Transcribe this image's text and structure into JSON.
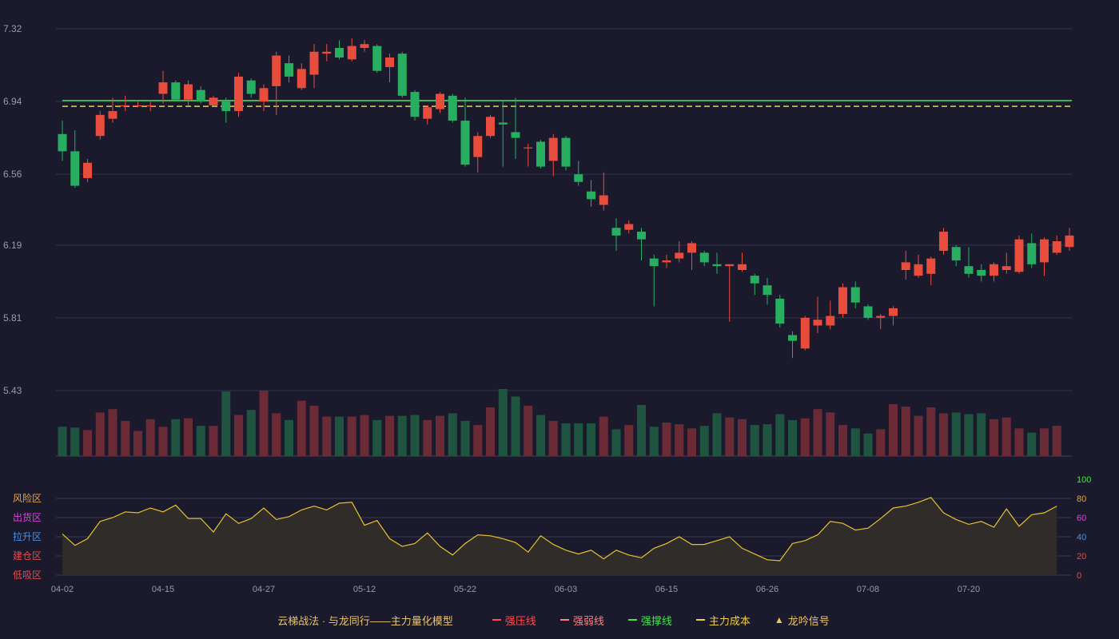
{
  "chart_data": {
    "type": "candlestick",
    "main_chart": {
      "y_ticks": [
        "7.32",
        "6.94",
        "6.56",
        "6.19",
        "5.81",
        "5.43"
      ],
      "ylim": [
        5.43,
        7.32
      ],
      "reference_lines": [
        {
          "key": "support",
          "value": 6.945,
          "color": "#3ee64b",
          "style": "solid"
        },
        {
          "key": "cost",
          "value": 6.915,
          "color": "#f0d03c",
          "style": "dashed"
        }
      ],
      "candles": [
        [
          6.77,
          6.68,
          6.63,
          6.84
        ],
        [
          6.68,
          6.5,
          6.49,
          6.79
        ],
        [
          6.54,
          6.62,
          6.52,
          6.64
        ],
        [
          6.76,
          6.87,
          6.74,
          6.89
        ],
        [
          6.85,
          6.89,
          6.83,
          6.96
        ],
        [
          6.92,
          6.92,
          6.89,
          6.97
        ],
        [
          6.92,
          6.92,
          6.91,
          6.94
        ],
        [
          6.92,
          6.92,
          6.89,
          6.94
        ],
        [
          6.98,
          7.04,
          6.93,
          7.1
        ],
        [
          7.04,
          6.95,
          6.94,
          7.05
        ],
        [
          6.95,
          7.03,
          6.92,
          7.05
        ],
        [
          7.0,
          6.94,
          6.93,
          7.02
        ],
        [
          6.92,
          6.96,
          6.92,
          6.97
        ],
        [
          6.94,
          6.89,
          6.83,
          6.96
        ],
        [
          6.89,
          7.07,
          6.86,
          7.09
        ],
        [
          7.05,
          6.98,
          6.96,
          7.06
        ],
        [
          6.94,
          7.01,
          6.89,
          7.03
        ],
        [
          7.02,
          7.18,
          6.87,
          7.2
        ],
        [
          7.14,
          7.07,
          7.04,
          7.18
        ],
        [
          7.01,
          7.11,
          7.0,
          7.14
        ],
        [
          7.08,
          7.2,
          7.01,
          7.24
        ],
        [
          7.19,
          7.2,
          7.15,
          7.24
        ],
        [
          7.22,
          7.17,
          7.16,
          7.26
        ],
        [
          7.16,
          7.23,
          7.15,
          7.27
        ],
        [
          7.22,
          7.24,
          7.2,
          7.26
        ],
        [
          7.23,
          7.1,
          7.09,
          7.24
        ],
        [
          7.12,
          7.17,
          7.04,
          7.19
        ],
        [
          7.19,
          6.97,
          6.96,
          7.2
        ],
        [
          6.99,
          6.86,
          6.84,
          7.0
        ],
        [
          6.85,
          6.91,
          6.82,
          6.92
        ],
        [
          6.9,
          6.98,
          6.88,
          6.99
        ],
        [
          6.97,
          6.84,
          6.83,
          6.98
        ],
        [
          6.84,
          6.61,
          6.6,
          6.96
        ],
        [
          6.65,
          6.76,
          6.57,
          6.78
        ],
        [
          6.76,
          6.86,
          6.75,
          6.87
        ],
        [
          6.83,
          6.82,
          6.6,
          6.94
        ],
        [
          6.78,
          6.75,
          6.64,
          6.96
        ],
        [
          6.7,
          6.7,
          6.6,
          6.72
        ],
        [
          6.73,
          6.6,
          6.59,
          6.74
        ],
        [
          6.63,
          6.75,
          6.55,
          6.77
        ],
        [
          6.75,
          6.6,
          6.58,
          6.76
        ],
        [
          6.56,
          6.52,
          6.5,
          6.63
        ],
        [
          6.47,
          6.43,
          6.39,
          6.53
        ],
        [
          6.4,
          6.45,
          6.37,
          6.57
        ],
        [
          6.28,
          6.24,
          6.16,
          6.33
        ],
        [
          6.27,
          6.3,
          6.25,
          6.32
        ],
        [
          6.26,
          6.22,
          6.11,
          6.28
        ],
        [
          6.12,
          6.08,
          5.87,
          6.14
        ],
        [
          6.1,
          6.11,
          6.07,
          6.14
        ],
        [
          6.12,
          6.15,
          6.1,
          6.21
        ],
        [
          6.15,
          6.2,
          6.06,
          6.21
        ],
        [
          6.15,
          6.1,
          6.08,
          6.16
        ],
        [
          6.09,
          6.08,
          6.04,
          6.15
        ],
        [
          6.08,
          6.09,
          5.79,
          6.09
        ],
        [
          6.06,
          6.09,
          6.05,
          6.15
        ],
        [
          6.03,
          5.99,
          5.93,
          6.04
        ],
        [
          5.98,
          5.93,
          5.88,
          6.02
        ],
        [
          5.91,
          5.78,
          5.76,
          5.93
        ],
        [
          5.72,
          5.69,
          5.6,
          5.74
        ],
        [
          5.65,
          5.81,
          5.64,
          5.82
        ],
        [
          5.77,
          5.8,
          5.73,
          5.92
        ],
        [
          5.77,
          5.82,
          5.75,
          5.9
        ],
        [
          5.83,
          5.97,
          5.81,
          5.99
        ],
        [
          5.97,
          5.89,
          5.86,
          6.0
        ],
        [
          5.87,
          5.81,
          5.8,
          5.88
        ],
        [
          5.81,
          5.82,
          5.75,
          5.83
        ],
        [
          5.82,
          5.86,
          5.77,
          5.87
        ],
        [
          6.06,
          6.1,
          6.01,
          6.16
        ],
        [
          6.03,
          6.09,
          6.02,
          6.14
        ],
        [
          6.04,
          6.12,
          5.98,
          6.13
        ],
        [
          6.16,
          6.26,
          6.14,
          6.28
        ],
        [
          6.18,
          6.11,
          6.08,
          6.19
        ],
        [
          6.08,
          6.04,
          6.02,
          6.18
        ],
        [
          6.06,
          6.03,
          6.0,
          6.09
        ],
        [
          6.03,
          6.09,
          6.0,
          6.1
        ],
        [
          6.06,
          6.08,
          6.04,
          6.15
        ],
        [
          6.05,
          6.22,
          6.04,
          6.24
        ],
        [
          6.2,
          6.09,
          6.07,
          6.25
        ],
        [
          6.1,
          6.22,
          6.03,
          6.23
        ],
        [
          6.15,
          6.21,
          6.14,
          6.24
        ],
        [
          6.18,
          6.24,
          6.16,
          6.28
        ]
      ]
    },
    "volume": {
      "values": [
        35,
        34,
        31,
        52,
        56,
        42,
        30,
        44,
        35,
        44,
        45,
        36,
        36,
        77,
        49,
        55,
        78,
        51,
        43,
        66,
        60,
        47,
        47,
        47,
        49,
        43,
        48,
        48,
        49,
        43,
        48,
        51,
        42,
        37,
        58,
        80,
        71,
        60,
        49,
        42,
        39,
        39,
        39,
        47,
        32,
        37,
        61,
        35,
        40,
        38,
        33,
        36,
        51,
        46,
        44,
        37,
        38,
        50,
        43,
        45,
        56,
        52,
        37,
        33,
        27,
        32,
        62,
        59,
        48,
        58,
        51,
        52,
        50,
        51,
        44,
        46,
        33,
        28,
        33,
        36
      ],
      "colors_up": "#6b2b36",
      "colors_down": "#1f5440"
    },
    "indicator": {
      "values": [
        43,
        31,
        38,
        56,
        60,
        66,
        65,
        70,
        66,
        73,
        59,
        59,
        45,
        64,
        54,
        59,
        70,
        58,
        61,
        68,
        72,
        68,
        75,
        76,
        52,
        57,
        38,
        30,
        33,
        44,
        30,
        21,
        33,
        42,
        41,
        38,
        34,
        24,
        41,
        32,
        26,
        22,
        26,
        17,
        26,
        21,
        18,
        28,
        33,
        40,
        32,
        32,
        36,
        40,
        28,
        22,
        16,
        15,
        33,
        36,
        42,
        56,
        54,
        47,
        49,
        59,
        70,
        72,
        76,
        81,
        65,
        58,
        53,
        56,
        50,
        69,
        51,
        63,
        65,
        72
      ],
      "ylim": [
        0,
        100
      ],
      "right_ticks": [
        {
          "label": "100",
          "value": 100,
          "color": "#3ee64b"
        },
        {
          "label": "80",
          "value": 80,
          "color": "#e9a43a"
        },
        {
          "label": "60",
          "value": 60,
          "color": "#e040e0"
        },
        {
          "label": "40",
          "value": 40,
          "color": "#4a90e2"
        },
        {
          "label": "20",
          "value": 20,
          "color": "#e04c4c"
        },
        {
          "label": "0",
          "value": 0,
          "color": "#e04c4c"
        }
      ],
      "zones": [
        {
          "label": "风险区",
          "value": 80,
          "color": "#e9a43a"
        },
        {
          "label": "出货区",
          "value": 60,
          "color": "#e040e0"
        },
        {
          "label": "拉升区",
          "value": 40,
          "color": "#4a90e2"
        },
        {
          "label": "建仓区",
          "value": 20,
          "color": "#e04c4c"
        },
        {
          "label": "低吸区",
          "value": 0,
          "color": "#e04c4c"
        }
      ],
      "line_color": "#e8c22b"
    },
    "x_ticks": [
      {
        "label": "04-02",
        "index": 0
      },
      {
        "label": "04-15",
        "index": 8
      },
      {
        "label": "04-27",
        "index": 16
      },
      {
        "label": "05-12",
        "index": 24
      },
      {
        "label": "05-22",
        "index": 32
      },
      {
        "label": "06-03",
        "index": 40
      },
      {
        "label": "06-15",
        "index": 48
      },
      {
        "label": "06-26",
        "index": 56
      },
      {
        "label": "07-08",
        "index": 64
      },
      {
        "label": "07-20",
        "index": 72
      }
    ],
    "colors": {
      "up": "#e84c3d",
      "down": "#27ae60"
    }
  },
  "legend": {
    "title": "云梯战法 · 与龙同行——主力量化模型",
    "items": [
      {
        "label": "强压线",
        "color": "#ff4b4b",
        "style": "solid"
      },
      {
        "label": "强弱线",
        "color": "#ff8080",
        "style": "dashed"
      },
      {
        "label": "强撑线",
        "color": "#3ee64b",
        "style": "solid"
      },
      {
        "label": "主力成本",
        "color": "#f0d03c",
        "style": "dashed"
      },
      {
        "label": "龙吟信号",
        "color": "#e9c46a",
        "style": "triangle"
      }
    ]
  }
}
